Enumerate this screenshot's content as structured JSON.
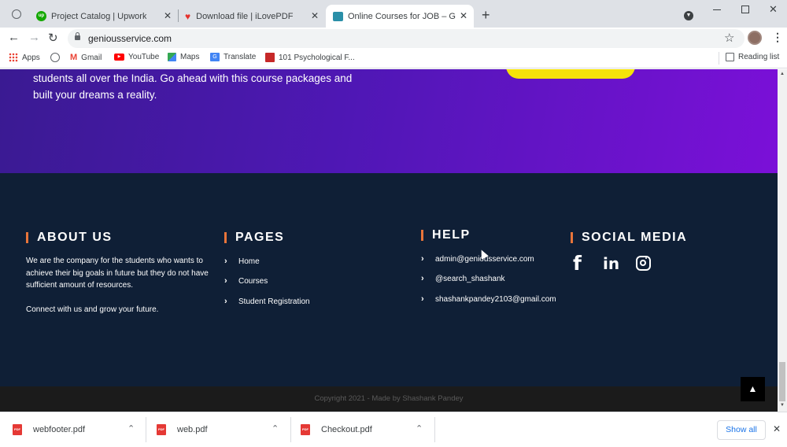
{
  "browser": {
    "tabs": [
      {
        "title": "Project Catalog | Upwork",
        "favicon": "upwork-icon",
        "active": false
      },
      {
        "title": "Download file | iLovePDF",
        "favicon": "heart-icon",
        "active": false
      },
      {
        "title": "Online Courses for JOB – Get hig",
        "favicon": "site-icon",
        "active": true
      }
    ],
    "new_tab_symbol": "+",
    "url": "geniousservice.com",
    "bookmarks": [
      {
        "label": "Apps",
        "icon": "apps-grid-icon"
      },
      {
        "label": "",
        "icon": "globe-icon"
      },
      {
        "label": "Gmail",
        "icon": "gmail-icon"
      },
      {
        "label": "YouTube",
        "icon": "youtube-icon"
      },
      {
        "label": "Maps",
        "icon": "maps-icon"
      },
      {
        "label": "Translate",
        "icon": "translate-icon"
      },
      {
        "label": "101 Psychological F...",
        "icon": "book-icon"
      }
    ],
    "reading_list": "Reading list"
  },
  "hero": {
    "line1": "students all over the India. Go ahead with this course packages and",
    "line2": "built your dreams a reality."
  },
  "footer": {
    "about": {
      "title": "ABOUT US",
      "p1": "We are the company for the students who wants to achieve their big goals in future but they do not have sufficient amount of resources.",
      "p2": "Connect with us and grow your future."
    },
    "pages": {
      "title": "PAGES",
      "links": [
        "Home",
        "Courses",
        "Student Registration"
      ]
    },
    "help": {
      "title": "HELP",
      "links": [
        "admin@geniousservice.com",
        "@search_shashank",
        "shashankpandey2103@gmail.com"
      ]
    },
    "social": {
      "title": "SOCIAL MEDIA",
      "icons": [
        "facebook-icon",
        "linkedin-icon",
        "instagram-icon"
      ]
    },
    "copyright": "Copyright 2021 - Made by Shashank Pandey"
  },
  "downloads": {
    "items": [
      "webfooter.pdf",
      "web.pdf",
      "Checkout.pdf"
    ],
    "show_all": "Show all"
  },
  "colors": {
    "footer_bg": "#0f1f36",
    "accent_bar": "#e8743a",
    "hero_start": "#3a1a92",
    "hero_end": "#7b10d8",
    "cta_yellow": "#f5e20a"
  }
}
